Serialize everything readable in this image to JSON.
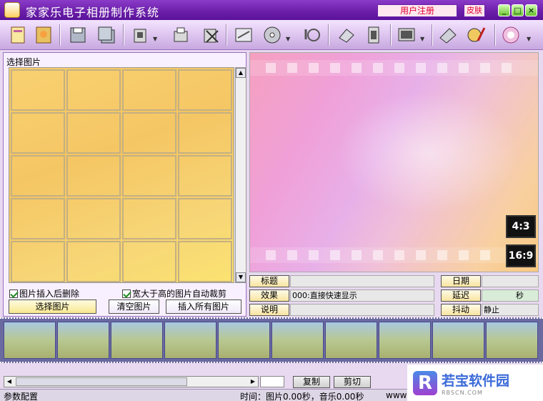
{
  "titlebar": {
    "title": "家家乐电子相册制作系统",
    "register": "用户注册",
    "skin": "皮肤",
    "min": "_",
    "max": "□",
    "close": "×"
  },
  "toolbar": {
    "icons": [
      "new-album-icon",
      "open-album-icon",
      "save-icon",
      "save-as-icon",
      "export-icon",
      "print-icon",
      "delete-icon",
      "text-effect-icon",
      "cd-icon",
      "music-icon",
      "settings-icon",
      "film-icon",
      "screen-icon",
      "scan-icon",
      "paint-icon",
      "help-icon"
    ]
  },
  "left": {
    "label": "选择图片",
    "chk1": "图片插入后删除",
    "chk2": "宽大于高的图片自动裁剪",
    "btn_select": "选择图片",
    "btn_clear": "清空图片",
    "btn_insert_all": "插入所有图片"
  },
  "preview": {
    "ratio1": "4:3",
    "ratio2": "16:9"
  },
  "props": {
    "title_label": "标题",
    "title_value": "",
    "effect_label": "效果",
    "effect_value": "000:直接快速显示",
    "desc_label": "说明",
    "desc_value": "",
    "date_label": "日期",
    "date_value": "",
    "delay_label": "延迟",
    "delay_value": "秒",
    "shake_label": "抖动",
    "shake_value": "静止"
  },
  "bottom": {
    "copy": "复制",
    "cut": "剪切"
  },
  "status": {
    "left": "参数配置",
    "time": "时间：图片0.00秒，音乐0.00秒",
    "www": "www"
  },
  "watermark": {
    "name": "若宝软件园",
    "sub": "RBSCN.COM",
    "logo": "R"
  }
}
